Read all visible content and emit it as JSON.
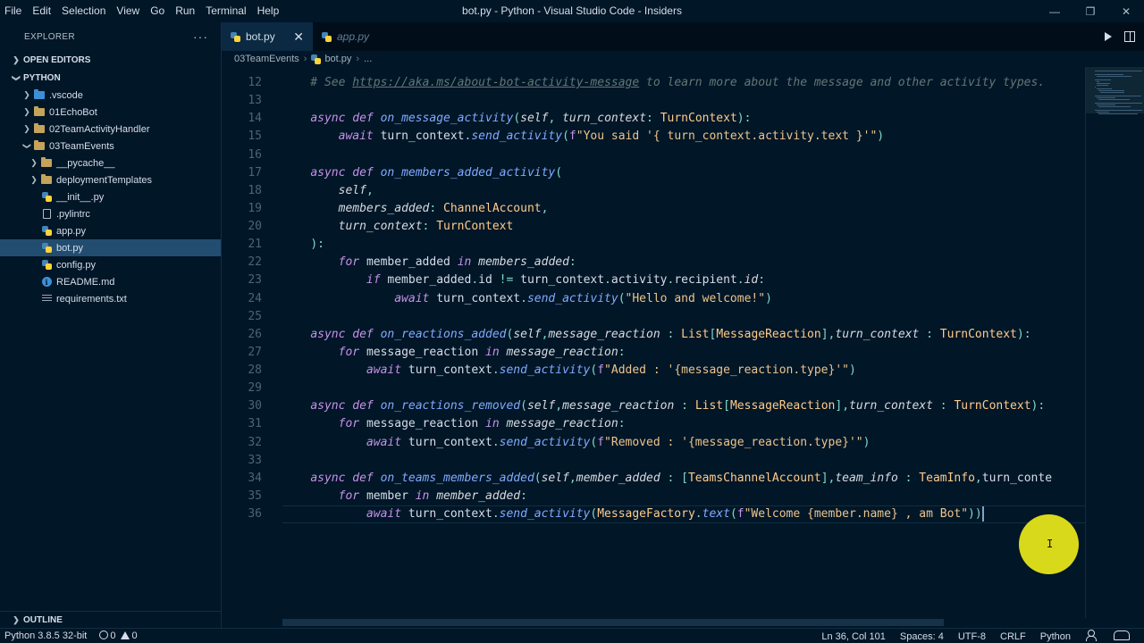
{
  "titlebar": {
    "menu": [
      "File",
      "Edit",
      "Selection",
      "View",
      "Go",
      "Run",
      "Terminal",
      "Help"
    ],
    "title": "bot.py - Python - Visual Studio Code - Insiders"
  },
  "sidebar": {
    "header": "EXPLORER",
    "open_editors": "OPEN EDITORS",
    "workspace": "PYTHON",
    "tree": [
      {
        "label": ".vscode",
        "kind": "folder-vscode",
        "indent": 1,
        "chevron": "right"
      },
      {
        "label": "01EchoBot",
        "kind": "folder",
        "indent": 1,
        "chevron": "right"
      },
      {
        "label": "02TeamActivityHandler",
        "kind": "folder",
        "indent": 1,
        "chevron": "right"
      },
      {
        "label": "03TeamEvents",
        "kind": "folder",
        "indent": 1,
        "chevron": "down"
      },
      {
        "label": "__pycache__",
        "kind": "folder",
        "indent": 2,
        "chevron": "right"
      },
      {
        "label": "deploymentTemplates",
        "kind": "folder",
        "indent": 2,
        "chevron": "right"
      },
      {
        "label": "__init__.py",
        "kind": "python",
        "indent": 2
      },
      {
        "label": ".pylintrc",
        "kind": "doc",
        "indent": 2
      },
      {
        "label": "app.py",
        "kind": "python",
        "indent": 2
      },
      {
        "label": "bot.py",
        "kind": "python",
        "indent": 2,
        "selected": true
      },
      {
        "label": "config.py",
        "kind": "python",
        "indent": 2
      },
      {
        "label": "README.md",
        "kind": "info",
        "indent": 2
      },
      {
        "label": "requirements.txt",
        "kind": "lines",
        "indent": 2
      }
    ],
    "outline": "OUTLINE"
  },
  "tabs": [
    {
      "label": "bot.py",
      "active": true,
      "close": "✕"
    },
    {
      "label": "app.py",
      "active": false
    }
  ],
  "breadcrumb": {
    "folder": "03TeamEvents",
    "file": "bot.py",
    "tail": "..."
  },
  "editor": {
    "lines": [
      {
        "n": "12",
        "text": "    # See https://aka.ms/about-bot-activity-message to learn more about the message and other activity types."
      },
      {
        "n": "13",
        "text": ""
      },
      {
        "n": "14",
        "text": "    async def on_message_activity(self, turn_context: TurnContext):"
      },
      {
        "n": "15",
        "text": "        await turn_context.send_activity(f\"You said '{ turn_context.activity.text }'\")"
      },
      {
        "n": "16",
        "text": ""
      },
      {
        "n": "17",
        "text": "    async def on_members_added_activity("
      },
      {
        "n": "18",
        "text": "        self,"
      },
      {
        "n": "19",
        "text": "        members_added: ChannelAccount,"
      },
      {
        "n": "20",
        "text": "        turn_context: TurnContext"
      },
      {
        "n": "21",
        "text": "    ):"
      },
      {
        "n": "22",
        "text": "        for member_added in members_added:"
      },
      {
        "n": "23",
        "text": "            if member_added.id != turn_context.activity.recipient.id:"
      },
      {
        "n": "24",
        "text": "                await turn_context.send_activity(\"Hello and welcome!\")"
      },
      {
        "n": "25",
        "text": ""
      },
      {
        "n": "26",
        "text": "    async def on_reactions_added(self,message_reaction : List[MessageReaction],turn_context : TurnContext):"
      },
      {
        "n": "27",
        "text": "        for message_reaction in message_reaction:"
      },
      {
        "n": "28",
        "text": "            await turn_context.send_activity(f\"Added : '{message_reaction.type}'\")"
      },
      {
        "n": "29",
        "text": ""
      },
      {
        "n": "30",
        "text": "    async def on_reactions_removed(self,message_reaction : List[MessageReaction],turn_context : TurnContext):"
      },
      {
        "n": "31",
        "text": "        for message_reaction in message_reaction:"
      },
      {
        "n": "32",
        "text": "            await turn_context.send_activity(f\"Removed : '{message_reaction.type}'\")"
      },
      {
        "n": "33",
        "text": ""
      },
      {
        "n": "34",
        "text": "    async def on_teams_members_added(self,member_added : [TeamsChannelAccount],team_info : TeamInfo,turn_conte"
      },
      {
        "n": "35",
        "text": "        for member in member_added:"
      },
      {
        "n": "36",
        "text": "            await turn_context.send_activity(MessageFactory.text(f\"Welcome {member.name} , am Bot\"))",
        "current": true
      }
    ]
  },
  "statusbar": {
    "interpreter": "Python 3.8.5 32-bit",
    "errors": "0",
    "warnings": "0",
    "position": "Ln 36, Col 101",
    "spaces": "Spaces: 4",
    "encoding": "UTF-8",
    "eol": "CRLF",
    "language": "Python"
  },
  "colors": {
    "background": "#011627",
    "keyword": "#c792ea",
    "function": "#82aaff",
    "string": "#ecc48d",
    "comment": "#637777",
    "param": "#d7dbe0",
    "type": "#ffcb8b",
    "selection": "#234d70"
  }
}
